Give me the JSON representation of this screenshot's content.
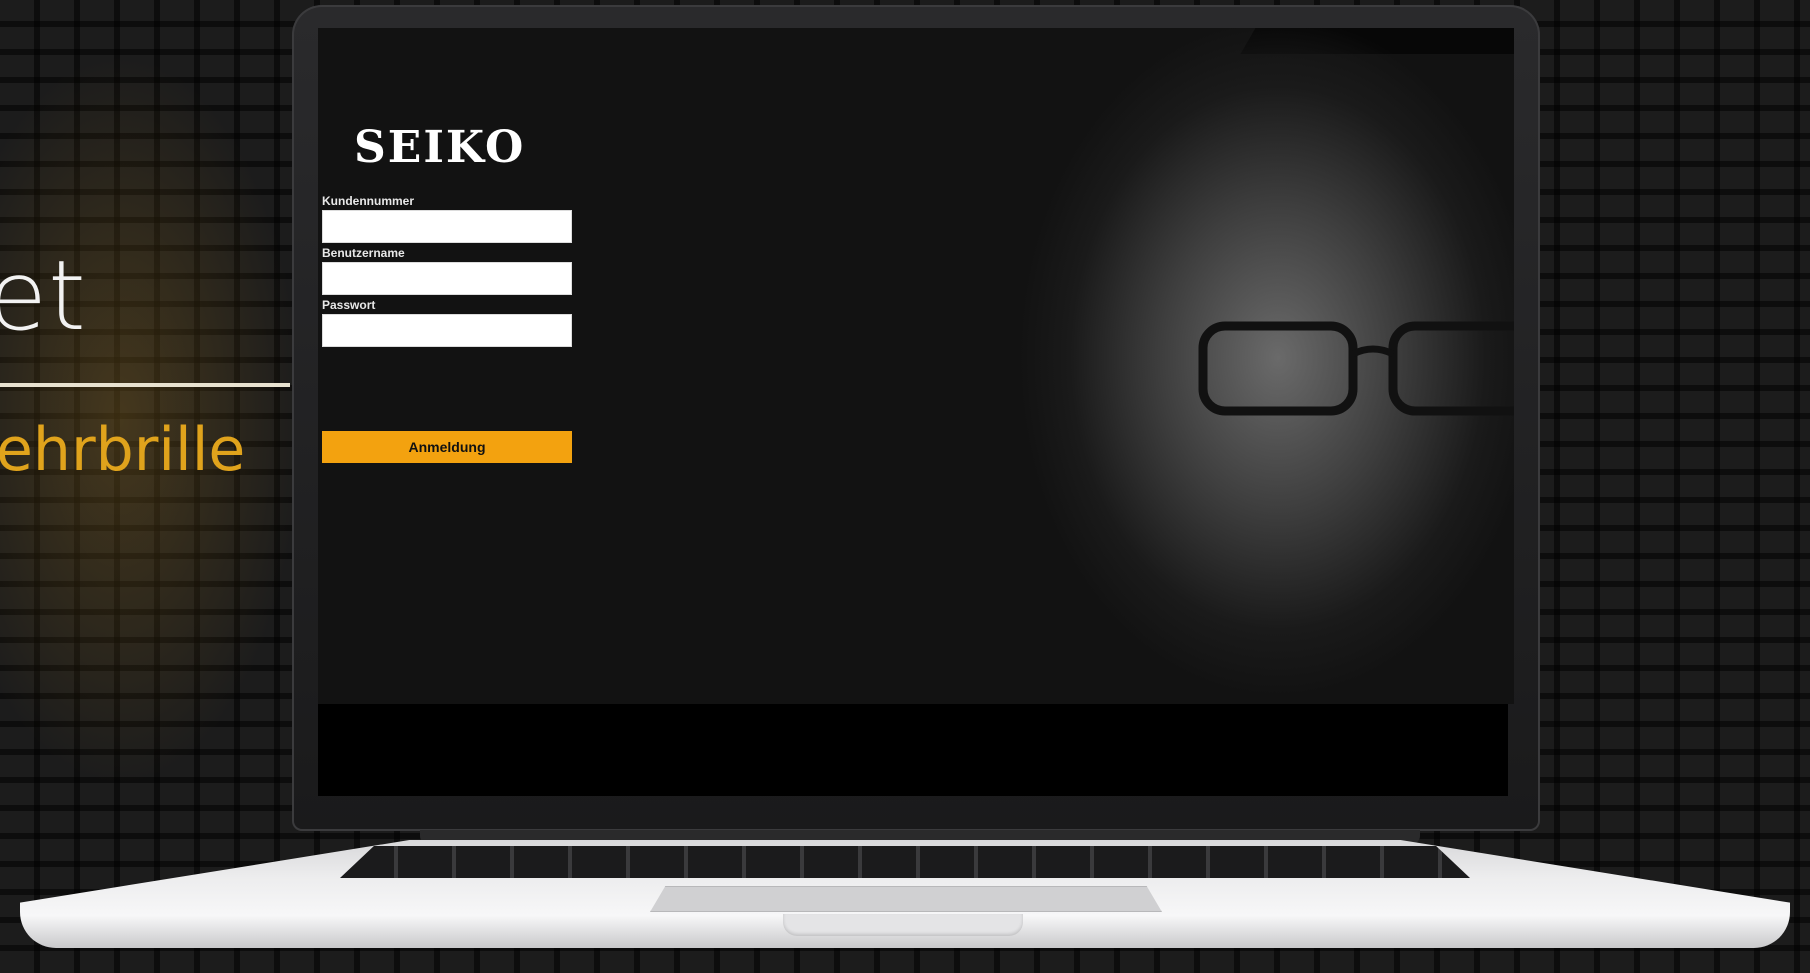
{
  "background": {
    "title_fragment": "et",
    "subtitle_fragment": "ehrbrille",
    "accent_color": "#e0a31c"
  },
  "login": {
    "logo_text": "SEIKO",
    "fields": [
      {
        "label": "Kundennummer",
        "value": "",
        "placeholder": ""
      },
      {
        "label": "Benutzername",
        "value": "",
        "placeholder": ""
      },
      {
        "label": "Passwort",
        "value": "",
        "placeholder": ""
      }
    ],
    "submit_label": "Anmeldung",
    "button_color": "#f3a20f"
  },
  "hero_image": {
    "description_icon": "portrait-photo"
  }
}
